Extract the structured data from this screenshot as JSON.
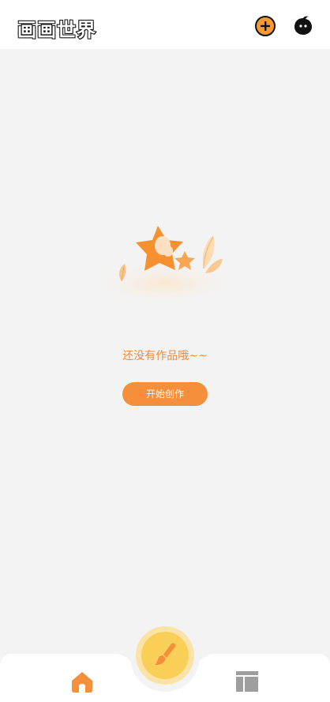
{
  "header": {
    "logo_text": "画画世界",
    "add_icon": "plus-circle-icon",
    "avatar_icon": "avatar-face-icon"
  },
  "empty_state": {
    "illustration": "star-with-leaves-illustration",
    "message": "还没有作品哦~~",
    "action_label": "开始创作"
  },
  "bottom_nav": {
    "home_icon": "home-icon",
    "create_icon": "paintbrush-icon",
    "works_icon": "layout-icon"
  },
  "colors": {
    "accent": "#f58f3b",
    "accent_light": "#f9cf58",
    "background": "#f3f3f3",
    "nav_inactive": "#9e9e9e"
  }
}
